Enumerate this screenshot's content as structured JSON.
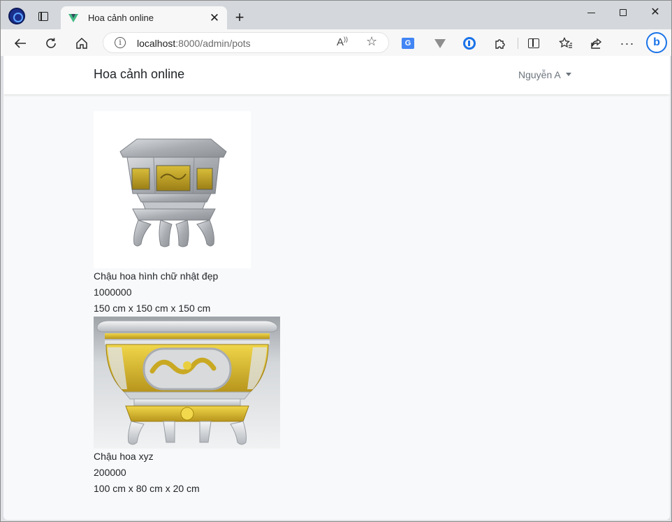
{
  "browser": {
    "tab_title": "Hoa cảnh online",
    "url_host": "localhost",
    "url_path": ":8000/admin/pots",
    "icons": {
      "profile": "profile-icon",
      "tab_actions": "tab-actions-icon",
      "favicon": "vue-favicon-icon",
      "close_tab": "close-icon",
      "new_tab": "plus-icon",
      "back": "arrow-left-icon",
      "reload": "reload-icon",
      "home": "home-icon",
      "site_info": "info-icon",
      "read_aloud": "read-aloud-icon",
      "favorite": "star-icon",
      "translate_ext": "translate-icon",
      "vue_devtools_ext": "vue-devtools-icon",
      "password_ext": "password-manager-icon",
      "extensions": "puzzle-icon",
      "split_screen": "split-screen-icon",
      "favorites": "favorites-icon",
      "share": "share-icon",
      "more": "more-icon",
      "copilot": "bing-icon"
    }
  },
  "navbar": {
    "brand": "Hoa cảnh online",
    "user_name": "Nguyễn A"
  },
  "pots": [
    {
      "name": "Chậu hoa hình chữ nhật đẹp",
      "price": "1000000",
      "size": "150 cm x 150 cm x 150 cm"
    },
    {
      "name": "Chậu hoa xyz",
      "price": "200000",
      "size": "100 cm x 80 cm x 20 cm"
    }
  ],
  "colors": {
    "page_bg": "#f8f9fa",
    "navbar_bg": "#ffffff",
    "text": "#212529",
    "muted": "#6c757d",
    "pot_gold": "#c9a924",
    "pot_silver": "#a9adb2"
  }
}
